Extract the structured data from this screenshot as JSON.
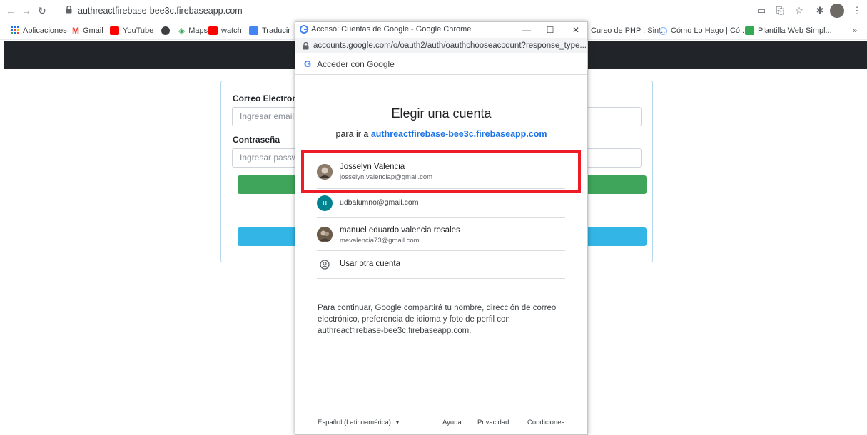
{
  "browser": {
    "back_icon": "arrow-left-icon",
    "forward_icon": "arrow-right-icon",
    "reload_icon": "reload-icon",
    "url": "authreactfirebase-bee3c.firebaseapp.com",
    "bookmarks": [
      {
        "label": "Aplicaciones",
        "color": "#4285f4"
      },
      {
        "label": "Gmail",
        "color": "#ea4335"
      },
      {
        "label": "YouTube",
        "color": "#ff0000"
      },
      {
        "label": "",
        "color": "#3c4043"
      },
      {
        "label": "Maps",
        "color": "#34a853"
      },
      {
        "label": "watch",
        "color": "#ff0000"
      },
      {
        "label": "Traducir",
        "color": "#4285f4"
      },
      {
        "label": "Curso de PHP : Sint...",
        "color": "#ffffff"
      },
      {
        "label": "Cómo Lo Hago | Có...",
        "color": "#80b4ff"
      },
      {
        "label": "Plantilla Web Simpl...",
        "color": "#34a853"
      }
    ],
    "more_bookmarks": "»"
  },
  "page": {
    "email_label": "Correo Electronico",
    "email_placeholder": "Ingresar email",
    "password_label": "Contraseña",
    "password_placeholder": "Ingresar password",
    "primary_color": "#3fa55b",
    "secondary_color": "#33b5e5"
  },
  "popup": {
    "window_title": "Acceso: Cuentas de Google - Google Chrome",
    "minimize": "—",
    "maximize": "☐",
    "close": "✕",
    "url": "accounts.google.com/o/oauth2/auth/oauthchooseaccount?response_type...",
    "header_g": "G",
    "header_label": "Acceder con Google",
    "title": "Elegir una cuenta",
    "subtitle_prefix": "para ir a",
    "subtitle_link": "authreactfirebase-bee3c.firebaseapp.com",
    "accounts": [
      {
        "name": "Josselyn Valencia",
        "email": "josselyn.valenciap@gmail.com",
        "avatar": "photo",
        "avatar_color": "#6d5a4a"
      },
      {
        "name": "",
        "email": "udbalumno@gmail.com",
        "avatar": "u",
        "avatar_color": "#00838f"
      },
      {
        "name": "manuel eduardo valencia rosales",
        "email": "mevalencia73@gmail.com",
        "avatar": "photo",
        "avatar_color": "#7a6a5a"
      }
    ],
    "other_account": "Usar otra cuenta",
    "privacy_text": "Para continuar, Google compartirá tu nombre, dirección de correo electrónico, preferencia de idioma y foto de perfil con authreactfirebase-bee3c.firebaseapp.com.",
    "footer": {
      "language": "Español (Latinoamérica)",
      "help": "Ayuda",
      "privacy": "Privacidad",
      "terms": "Condiciones"
    },
    "highlight_color": "#ee1c25"
  }
}
